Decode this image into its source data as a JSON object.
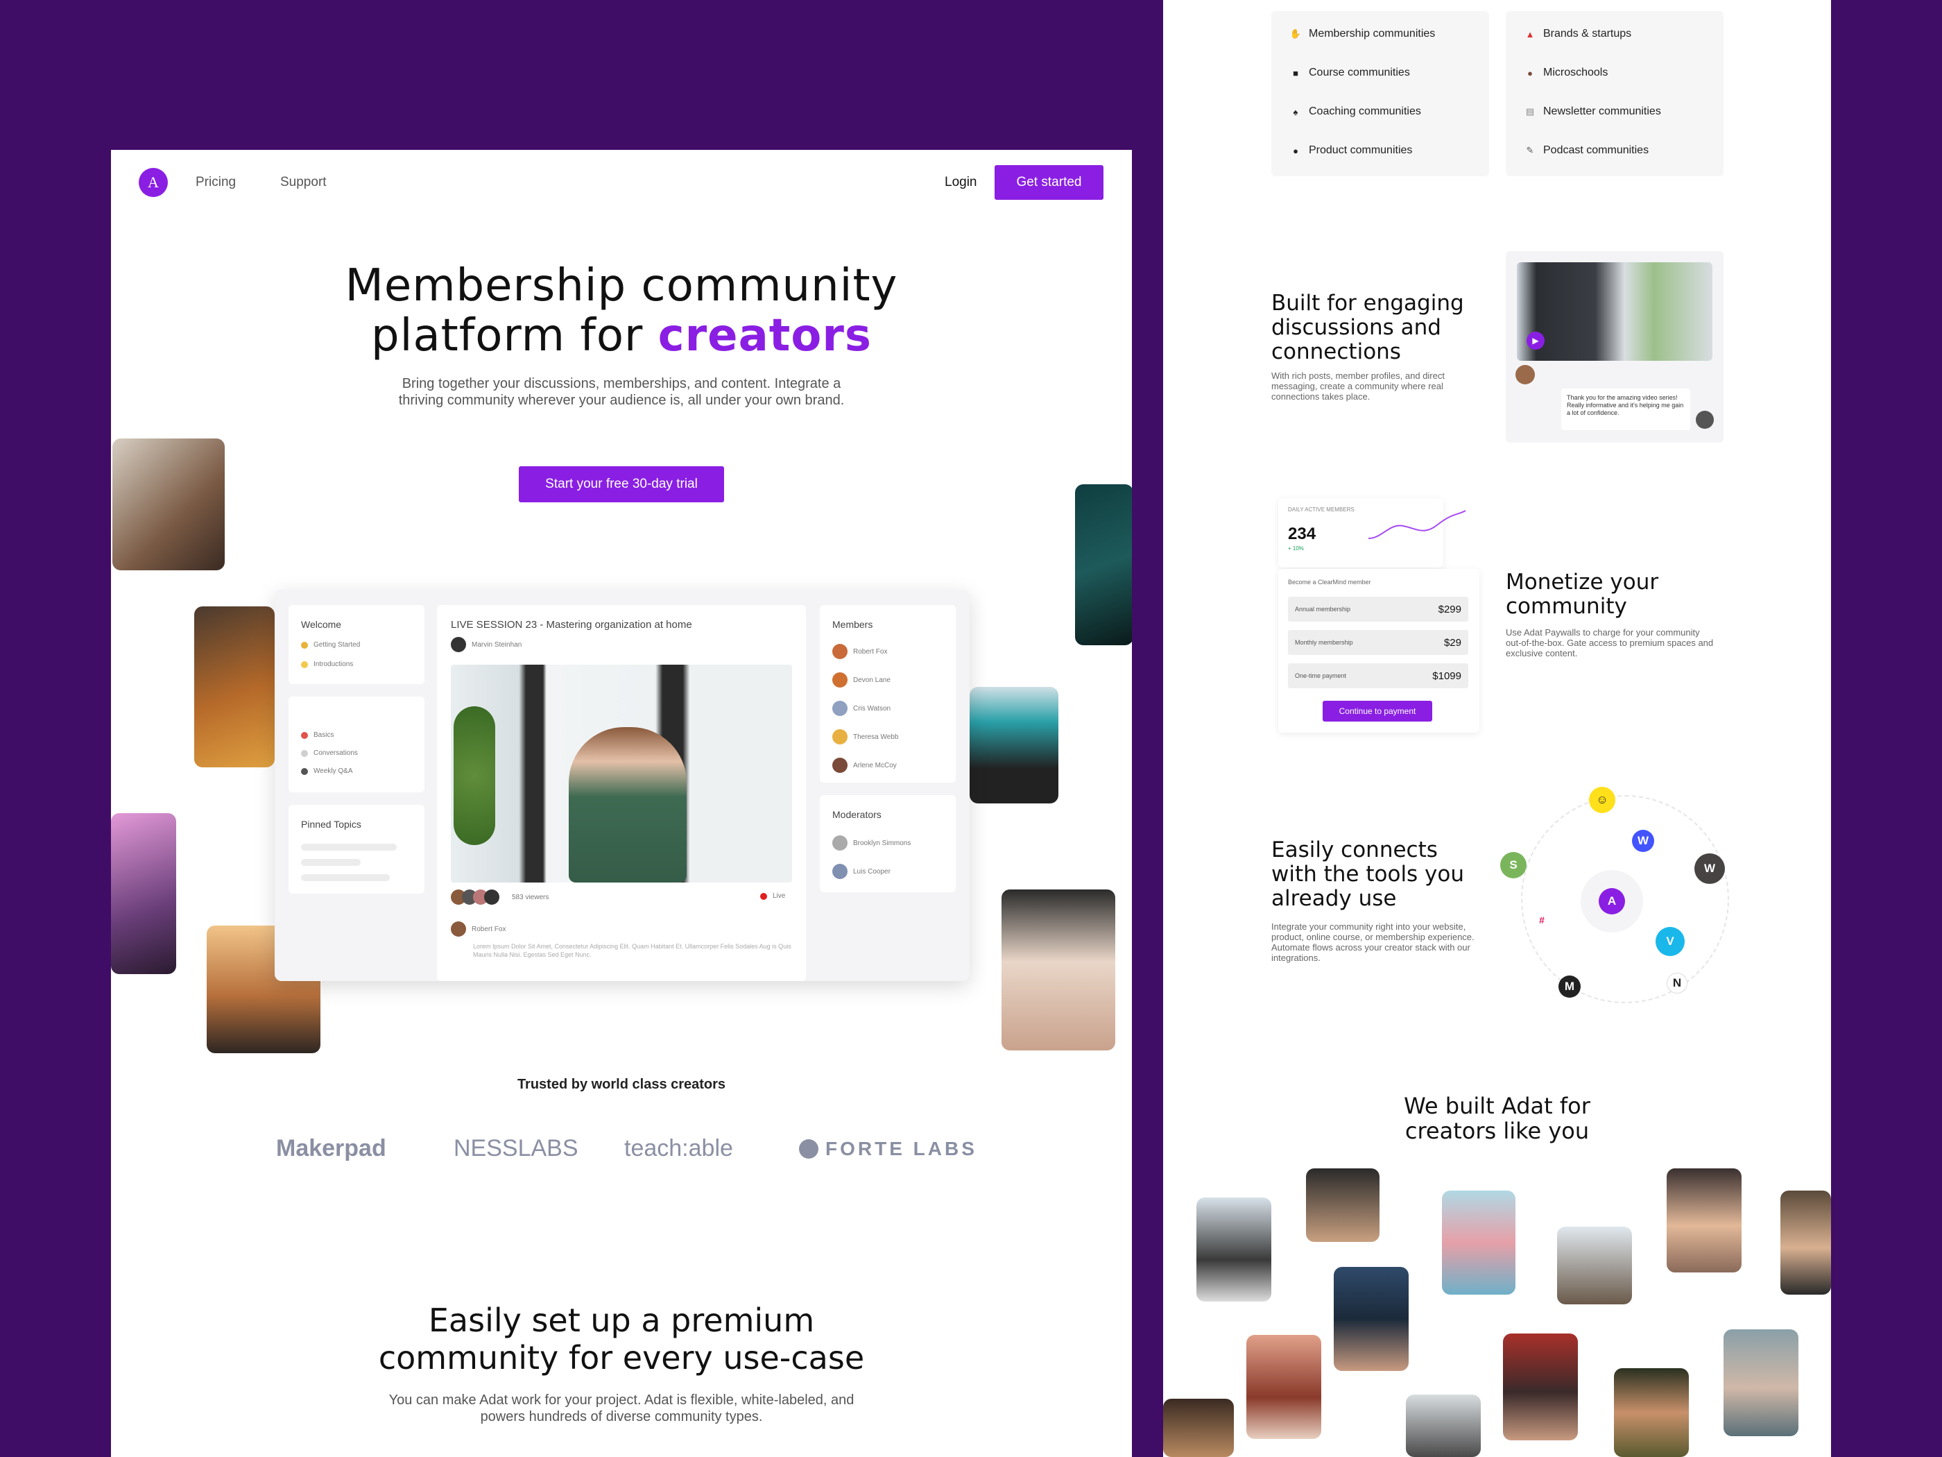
{
  "nav": {
    "logo_letter": "A",
    "links": [
      "Pricing",
      "Support"
    ],
    "login": "Login",
    "cta": "Get started"
  },
  "hero": {
    "title_line1": "Membership community",
    "title_line2_pre": "platform for ",
    "title_accent": "creators",
    "subtitle": "Bring together your discussions, memberships, and content. Integrate a thriving community wherever your audience is, all under your own brand.",
    "cta": "Start your free 30-day trial"
  },
  "mockup": {
    "welcome": {
      "title": "Welcome",
      "items": [
        {
          "label": "Getting Started",
          "color": "#e8b23a"
        },
        {
          "label": "Introductions",
          "color": "#f2c94c"
        }
      ]
    },
    "spaces": {
      "items": [
        {
          "label": "Basics",
          "color": "#e0524a"
        },
        {
          "label": "Conversations",
          "color": "#cfcfcf"
        },
        {
          "label": "Weekly Q&A",
          "color": "#555"
        }
      ]
    },
    "pinned": {
      "title": "Pinned Topics"
    },
    "session": {
      "title": "LIVE SESSION 23 - Mastering organization at home",
      "host": "Marvin Steinhan",
      "viewers": "583 viewers",
      "live": "Live",
      "comment_author": "Robert Fox",
      "comment_text": "Lorem Ipsum Dolor Sit Amet, Consectetur Adipiscing Elit. Quam Habitant Et. Ullamcorper Felis Sodales Aug is Quis Mauris Nulla Nisi. Egestas Sed Eget Nunc."
    },
    "members": {
      "title": "Members",
      "items": [
        "Robert Fox",
        "Devon Lane",
        "Cris Watson",
        "Theresa Webb",
        "Arlene McCoy"
      ]
    },
    "moderators": {
      "title": "Moderators",
      "items": [
        "Brooklyn Simmons",
        "Luis Cooper"
      ]
    }
  },
  "trusted": {
    "title": "Trusted by world class creators",
    "logos": [
      "Makerpad",
      "NESSLABS",
      "teach:able",
      "FORTE LABS"
    ]
  },
  "setup": {
    "title_line1": "Easily set up a premium",
    "title_line2": "community for every use-case",
    "subtitle": "You can make Adat work for your project. Adat is flexible, white-labeled, and powers hundreds of diverse community types."
  },
  "use_cases": {
    "col1": [
      {
        "label": "Membership communities",
        "icon": "wave-hand-icon"
      },
      {
        "label": "Course communities",
        "icon": "books-icon"
      },
      {
        "label": "Coaching communities",
        "icon": "whistle-icon"
      },
      {
        "label": "Product communities",
        "icon": "bicycle-icon"
      }
    ],
    "col2": [
      {
        "label": "Brands & startups",
        "icon": "rocket-icon"
      },
      {
        "label": "Microschools",
        "icon": "person-icon"
      },
      {
        "label": "Newsletter communities",
        "icon": "newspaper-icon"
      },
      {
        "label": "Podcast communities",
        "icon": "microphone-icon"
      }
    ]
  },
  "features": {
    "discussions": {
      "title_line1": "Built for engaging",
      "title_line2": "discussions and",
      "title_line3": "connections",
      "desc": "With rich posts, member profiles, and direct messaging, create a community where real connections takes place.",
      "chat_text": "Thank you for the amazing video series! Really informative and it's helping me gain a lot of confidence."
    },
    "monetize": {
      "title_line1": "Monetize your",
      "title_line2": "community",
      "desc": "Use Adat Paywalls to charge for your community out-of-the-box. Gate access to premium spaces and exclusive content.",
      "stat_label": "DAILY ACTIVE MEMBERS",
      "stat_value": "234",
      "stat_change": "+ 10%",
      "join_title": "Become a ClearMind member",
      "plans": [
        {
          "label": "Annual membership",
          "price": "$299"
        },
        {
          "label": "Monthly membership",
          "price": "$29"
        },
        {
          "label": "One-time payment",
          "price": "$1099"
        }
      ],
      "pay_button": "Continue to payment"
    },
    "integrations": {
      "title_line1": "Easily connects",
      "title_line2": "with the tools you",
      "title_line3": "already use",
      "desc": "Integrate your community right into your website, product, online course, or membership experience. Automate flows across your creator stack with our integrations.",
      "center": "A",
      "tools": [
        {
          "name": "mailchimp-icon",
          "glyph": "☺",
          "color": "#ffe01b",
          "fg": "#222"
        },
        {
          "name": "webflow-icon",
          "glyph": "W",
          "color": "#4353ff",
          "fg": "#fff"
        },
        {
          "name": "wordpress-icon",
          "glyph": "W",
          "color": "#464342",
          "fg": "#fff"
        },
        {
          "name": "shopify-icon",
          "glyph": "S",
          "color": "#7ab55c",
          "fg": "#fff"
        },
        {
          "name": "slack-icon",
          "glyph": "#",
          "color": "#ffffff",
          "fg": "#e01e5a"
        },
        {
          "name": "vimeo-icon",
          "glyph": "V",
          "color": "#1ab7ea",
          "fg": "#fff"
        },
        {
          "name": "medium-icon",
          "glyph": "M",
          "color": "#222222",
          "fg": "#fff"
        },
        {
          "name": "notion-icon",
          "glyph": "N",
          "color": "#ffffff",
          "fg": "#222"
        }
      ]
    }
  },
  "creators": {
    "title_line1": "We built Adat for",
    "title_line2": "creators like you"
  },
  "colors": {
    "brand": "#8a1fe3",
    "background": "#3f0c66"
  }
}
